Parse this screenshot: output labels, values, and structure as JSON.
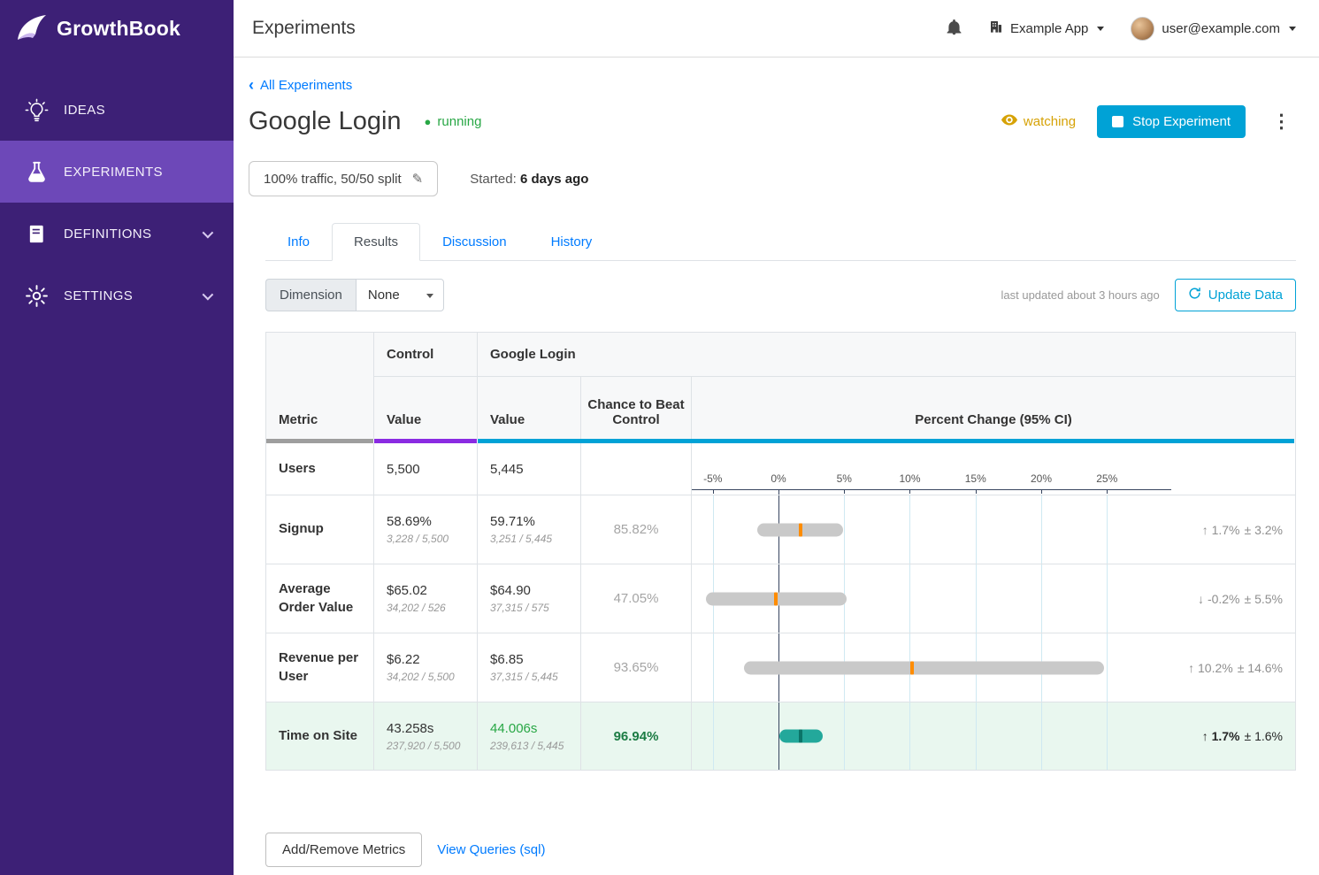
{
  "theme": {
    "sidebar_bg": "#3d2076",
    "sidebar_active_bg": "#6d48b8",
    "accent_cyan": "#00a2d6",
    "link_blue": "#007bff",
    "running_green": "#28a745",
    "watching_amber": "#d6a206",
    "metric_bar_color": "#9e9e9e",
    "control_bar_color": "#8a2be2",
    "variation_bar_color": "#00a2d6",
    "significant_row_bg": "#e9f7ef",
    "significant_green": "#1c7c44"
  },
  "sidebar": {
    "logo": "GrowthBook",
    "items": [
      {
        "label": "IDEAS"
      },
      {
        "label": "EXPERIMENTS"
      },
      {
        "label": "DEFINITIONS"
      },
      {
        "label": "SETTINGS"
      }
    ]
  },
  "topbar": {
    "title": "Experiments",
    "org": "Example App",
    "user": "user@example.com"
  },
  "experiment": {
    "breadcrumb": "All Experiments",
    "title": "Google Login",
    "status": "running",
    "watching_label": "watching",
    "stop_button": "Stop Experiment",
    "traffic_button": "100% traffic, 50/50 split",
    "started_label": "Started:",
    "started_value": "6 days ago"
  },
  "tabs": {
    "info": "Info",
    "results": "Results",
    "discussion": "Discussion",
    "history": "History"
  },
  "toolbar": {
    "dimension_label": "Dimension",
    "dimension_value": "None",
    "last_updated": "last updated about 3 hours ago",
    "update_button": "Update Data"
  },
  "footer": {
    "add_remove_button": "Add/Remove Metrics",
    "view_queries_link": "View Queries (sql)"
  },
  "icons": {
    "chevron_left": "‹",
    "running_dot": "●",
    "kebab": "⋮",
    "pencil": "✎"
  },
  "table": {
    "headers": {
      "metric": "Metric",
      "control": "Control",
      "variation": "Google Login",
      "value": "Value",
      "chance": "Chance to Beat Control",
      "percent_change": "Percent Change (95% CI)"
    },
    "axis": {
      "min": -6.6,
      "max": 29.9,
      "unit": "%",
      "ticks": [
        -5,
        0,
        5,
        10,
        15,
        20,
        25
      ]
    },
    "rows": [
      {
        "metric": "Users",
        "control": {
          "value": "5,500"
        },
        "variation": {
          "value": "5,445"
        }
      },
      {
        "metric": "Signup",
        "control": {
          "value": "58.69%",
          "detail": "3,228 / 5,500"
        },
        "variation": {
          "value": "59.71%",
          "detail": "3,251 / 5,445"
        },
        "chance": "85.82%",
        "ci": [
          -1.6,
          4.9
        ],
        "mean": 1.7,
        "bar_color": "#c9c9c9",
        "marker_color": "#ff8c00",
        "change": {
          "arrow": "↑",
          "value": "1.7%",
          "pm": "± 3.2%"
        },
        "significant": false
      },
      {
        "metric": "Average Order Value",
        "control": {
          "value": "$65.02",
          "detail": "34,202 / 526"
        },
        "variation": {
          "value": "$64.90",
          "detail": "37,315 / 575"
        },
        "chance": "47.05%",
        "ci": [
          -5.5,
          5.2
        ],
        "mean": -0.2,
        "bar_color": "#c9c9c9",
        "marker_color": "#ff8c00",
        "change": {
          "arrow": "↓",
          "value": "-0.2%",
          "pm": "± 5.5%"
        },
        "significant": false
      },
      {
        "metric": "Revenue per User",
        "control": {
          "value": "$6.22",
          "detail": "34,202 / 5,500"
        },
        "variation": {
          "value": "$6.85",
          "detail": "37,315 / 5,445"
        },
        "chance": "93.65%",
        "ci": [
          -2.6,
          24.8
        ],
        "mean": 10.2,
        "bar_color": "#c9c9c9",
        "marker_color": "#ff8c00",
        "change": {
          "arrow": "↑",
          "value": "10.2%",
          "pm": "± 14.6%"
        },
        "significant": false
      },
      {
        "metric": "Time on Site",
        "control": {
          "value": "43.258s",
          "detail": "237,920 / 5,500"
        },
        "variation": {
          "value": "44.006s",
          "detail": "239,613 / 5,445"
        },
        "chance": "96.94%",
        "ci": [
          0.1,
          3.4
        ],
        "mean": 1.7,
        "bar_color": "#23a89b",
        "marker_color": "#0b7468",
        "change": {
          "arrow": "↑",
          "value": "1.7%",
          "pm": "± 1.6%"
        },
        "significant": true
      }
    ]
  }
}
